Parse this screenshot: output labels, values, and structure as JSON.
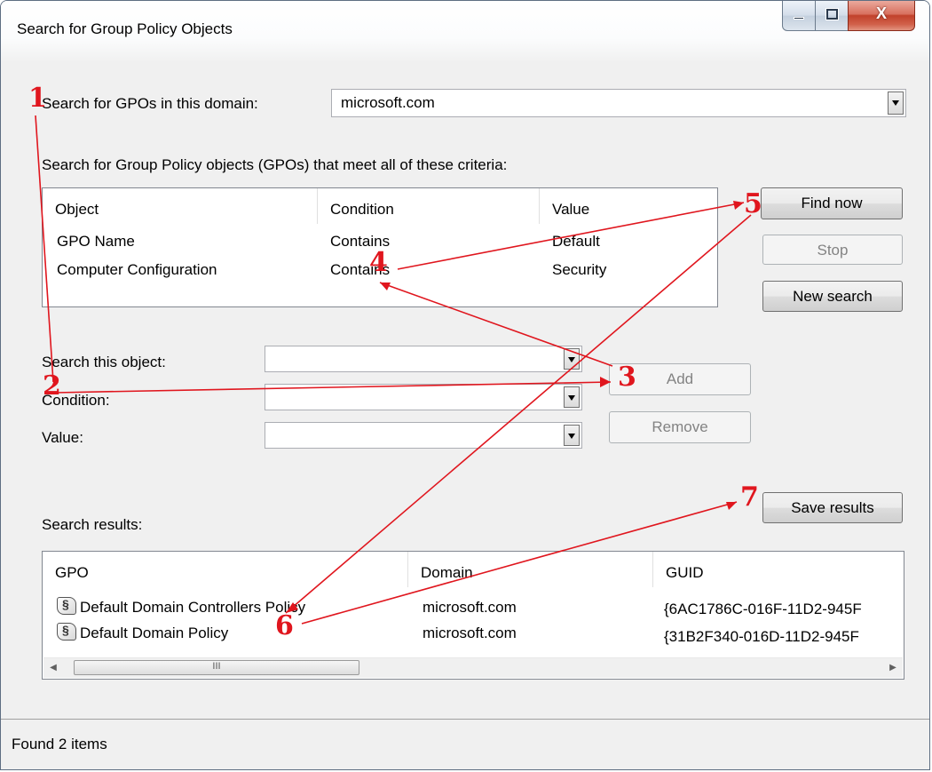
{
  "window": {
    "title": "Search for Group Policy Objects",
    "close_glyph": "X"
  },
  "domain": {
    "label": "Search for GPOs in this domain:",
    "value": "microsoft.com"
  },
  "criteria": {
    "heading": "Search for Group Policy objects (GPOs) that meet all of these criteria:",
    "columns": [
      "Object",
      "Condition",
      "Value"
    ],
    "rows": [
      {
        "object": "GPO Name",
        "condition": "Contains",
        "value": "Default"
      },
      {
        "object": "Computer Configuration",
        "condition": "Contains",
        "value": "Security"
      }
    ]
  },
  "buttons": {
    "find_now": "Find now",
    "stop": "Stop",
    "new_search": "New search",
    "add": "Add",
    "remove": "Remove",
    "save_results": "Save results"
  },
  "form": {
    "search_object_label": "Search this object:",
    "condition_label": "Condition:",
    "value_label": "Value:"
  },
  "results": {
    "label": "Search results:",
    "columns": [
      "GPO",
      "Domain",
      "GUID"
    ],
    "rows": [
      {
        "gpo": "Default Domain Controllers Policy",
        "domain": "microsoft.com",
        "guid": "{6AC1786C-016F-11D2-945F"
      },
      {
        "gpo": "Default Domain Policy",
        "domain": "microsoft.com",
        "guid": "{31B2F340-016D-11D2-945F"
      }
    ],
    "scroll_thumb_glyph": "III"
  },
  "status": {
    "text": "Found 2 items"
  },
  "annotations": {
    "color": "#e0161e",
    "markers": [
      "1",
      "2",
      "3",
      "4",
      "5",
      "6",
      "7"
    ]
  },
  "icons": {
    "gpo_row": "gpo-scroll-icon",
    "combo_arrow": "chevron-down-icon",
    "scroll_left": "arrow-left-icon",
    "scroll_right": "arrow-right-icon"
  }
}
